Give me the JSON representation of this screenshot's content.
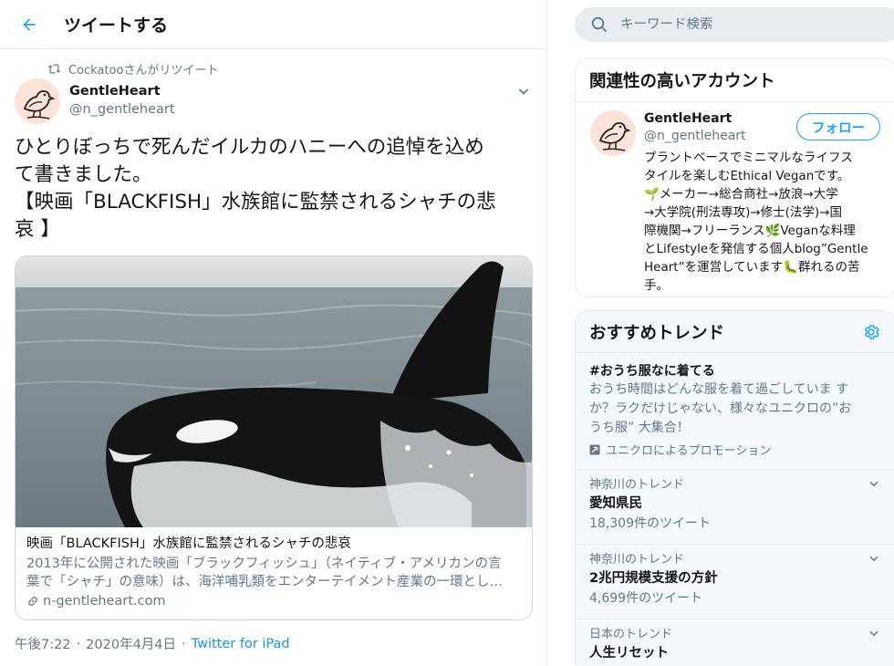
{
  "header": {
    "title": "ツイートする"
  },
  "tweet": {
    "retweeted_by": "Cockatooさんがリツイート",
    "author_name": "GentleHeart",
    "author_handle": "@n_gentleheart",
    "text_lines": [
      "ひとりぼっちで死んだイルカのハニーへの追悼を込め",
      "て書きました。",
      "【映画「BLACKFISH」水族館に監禁されるシャチの悲",
      "哀 】"
    ],
    "card": {
      "title": "映画「BLACKFISH」水族館に監禁されるシャチの悲哀",
      "desc_lines": [
        "2013年に公開された映画「ブラックフィッシュ」（ネイティブ・アメリカンの言",
        "葉で「シャチ」の意味）は、海洋哺乳類をエンターテイメント産業の一環とし…"
      ],
      "domain": "n-gentleheart.com"
    },
    "time": "午後7:22",
    "date": "2020年4月4日",
    "client": "Twitter for iPad"
  },
  "search": {
    "placeholder": "キーワード検索"
  },
  "related_accounts": {
    "title": "関連性の高いアカウント",
    "account": {
      "name": "GentleHeart",
      "handle": "@n_gentleheart",
      "follow_label": "フォロー",
      "bio_lines": [
        "プラントベースでミニマルなライフス",
        "タイルを楽しむEthical Veganです。",
        "🌱メーカー→総合商社→放浪→大学",
        "→大学院(刑法専攻)→修士(法学)→国",
        "際機関→フリーランス🌿Veganな料理",
        "とLifestyleを発信する個人blog”Gentle",
        "Heart”を運営しています🐛群れるの苦",
        "手。"
      ]
    }
  },
  "trends": {
    "title": "おすすめトレンド",
    "promoted": {
      "tag": "#おうち服なに着てる",
      "desc_lines": [
        "おうち時間はどんな服を着て過ごしていま す",
        "か？ラクだけじゃない、様々なユニクロの”お",
        "うち服” 大集合！"
      ],
      "by": "ユニクロによるプロモーション"
    },
    "items": [
      {
        "context": "神奈川のトレンド",
        "name": "愛知県民",
        "count": "18,309件のツイート"
      },
      {
        "context": "神奈川のトレンド",
        "name": "2兆円規模支援の方針",
        "count": "4,699件のツイート"
      },
      {
        "context": "日本のトレンド",
        "name": "人生リセット",
        "count": ""
      }
    ]
  },
  "colors": {
    "accent": "#1da1f2",
    "secondary_text": "#657786",
    "border": "#e6ecf0"
  }
}
